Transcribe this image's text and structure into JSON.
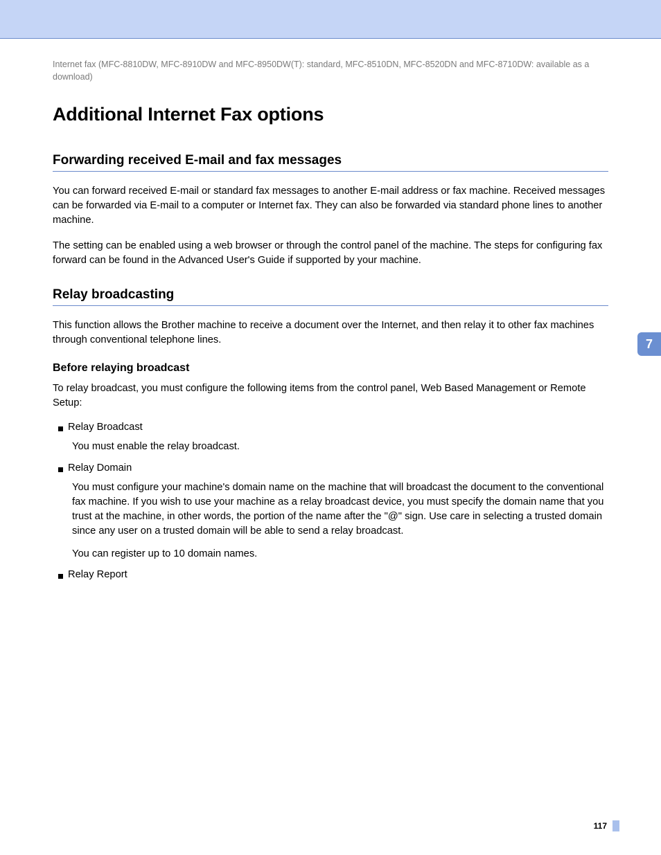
{
  "header_note": "Internet fax (MFC-8810DW, MFC-8910DW and MFC-8950DW(T): standard, MFC-8510DN, MFC-8520DN and MFC-8710DW: available as a download)",
  "title": "Additional Internet Fax options",
  "section1": {
    "heading": "Forwarding received E-mail and fax messages",
    "p1": "You can forward received E-mail or standard fax messages to another E-mail address or fax machine. Received messages can be forwarded via E-mail to a computer or Internet fax. They can also be forwarded via standard phone lines to another machine.",
    "p2": "The setting can be enabled using a web browser or through the control panel of the machine. The steps for configuring fax forward can be found in the Advanced User's Guide if supported by your machine."
  },
  "section2": {
    "heading": "Relay broadcasting",
    "p1": "This function allows the Brother machine to receive a document over the Internet, and then relay it to other fax machines through conventional telephone lines.",
    "sub_heading": "Before relaying broadcast",
    "sub_intro": "To relay broadcast, you must configure the following items from the control panel, Web Based Management or Remote Setup:",
    "items": [
      {
        "title": "Relay Broadcast",
        "desc": [
          "You must enable the relay broadcast."
        ]
      },
      {
        "title": "Relay Domain",
        "desc": [
          "You must configure your machine's domain name on the machine that will broadcast the document to the conventional fax machine. If you wish to use your machine as a relay broadcast device, you must specify the domain name that you trust at the machine, in other words, the portion of the name after the \"@\" sign. Use care in selecting a trusted domain since any user on a trusted domain will be able to send a relay broadcast.",
          "You can register up to 10 domain names."
        ]
      },
      {
        "title": "Relay Report",
        "desc": []
      }
    ]
  },
  "side_tab": "7",
  "page_number": "117"
}
